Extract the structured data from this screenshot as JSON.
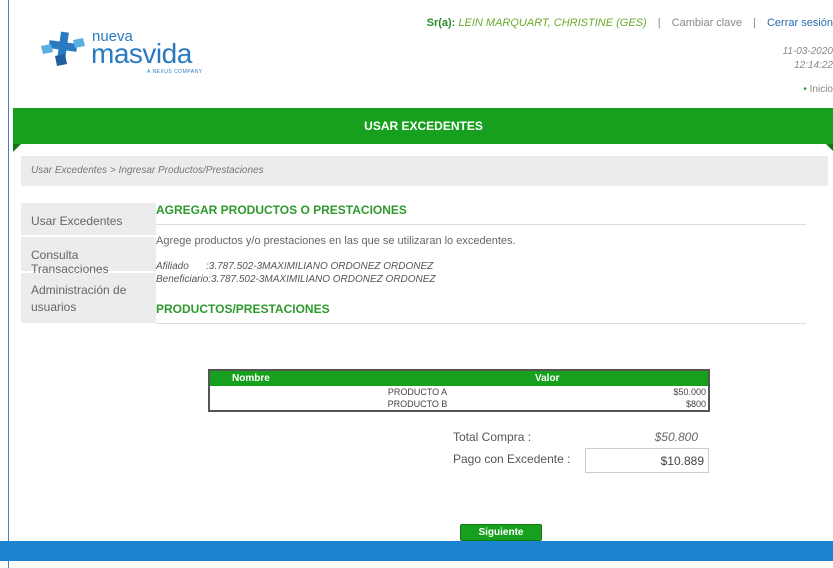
{
  "header": {
    "logo_small": "nueva",
    "logo_big": "masvida",
    "logo_tagline": "A NEXUS COMPANY",
    "user_prefix": "Sr(a):",
    "user_name": "LEIN MARQUART, CHRISTINE (GES)",
    "change_password": "Cambiar clave",
    "logout": "Cerrar sesión",
    "date": "11-03-2020",
    "time": "12:14:22",
    "home_link": "Inicio"
  },
  "banner": {
    "title": "USAR EXCEDENTES"
  },
  "breadcrumb": "Usar Excedentes > Ingresar Productos/Prestaciones",
  "sidebar": {
    "items": [
      {
        "label": "Usar Excedentes"
      },
      {
        "label": "Consulta Transacciones"
      },
      {
        "label": "Administración de usuarios"
      }
    ]
  },
  "main": {
    "section_title": "AGREGAR PRODUCTOS O PRESTACIONES",
    "description": "Agrege productos y/o prestaciones en las que se utilizaran lo excedentes.",
    "afiliado_label": "Afiliado",
    "afiliado_value": ":3.787.502-3MAXIMILIANO ORDONEZ ORDONEZ",
    "beneficiario_label": "Beneficiario",
    "beneficiario_value": ":3.787.502-3MAXIMILIANO ORDONEZ ORDONEZ",
    "products_title": "PRODUCTOS/PRESTACIONES"
  },
  "table": {
    "headers": [
      "Nombre",
      "Valor"
    ],
    "rows": [
      {
        "nombre": "PRODUCTO A",
        "valor": "$50.000"
      },
      {
        "nombre": "PRODUCTO B",
        "valor": "$800"
      }
    ]
  },
  "totals": {
    "total_label": "Total Compra :",
    "total_value": "$50.800",
    "pago_label": "Pago con Excedente :",
    "pago_value": "$10.889"
  },
  "actions": {
    "next_label": "Siguiente"
  },
  "colors": {
    "brand_green": "#17a01e",
    "footer_blue": "#1b84d0",
    "logo_blue": "#2a7ac0"
  }
}
